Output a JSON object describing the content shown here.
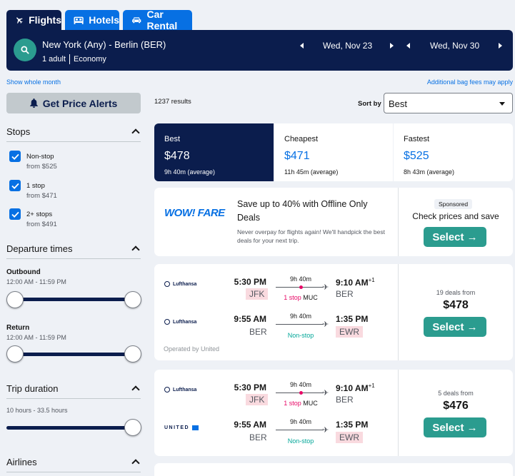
{
  "tabs": [
    {
      "label": "Flights",
      "icon": "plane-icon"
    },
    {
      "label": "Hotels",
      "icon": "bed-icon"
    },
    {
      "label": "Car Rental",
      "icon": "car-icon"
    }
  ],
  "search": {
    "route": "New York (Any) - Berlin (BER)",
    "passengers": "1 adult",
    "cabin": "Economy",
    "depart_date": "Wed, Nov 23",
    "return_date": "Wed, Nov 30"
  },
  "links": {
    "show_month": "Show whole month",
    "bag_fees": "Additional bag fees may apply"
  },
  "sidebar": {
    "alerts_button": "Get Price Alerts",
    "stops_title": "Stops",
    "stops": [
      {
        "label": "Non-stop",
        "price": "from $525",
        "checked": true
      },
      {
        "label": "1 stop",
        "price": "from $471",
        "checked": true
      },
      {
        "label": "2+ stops",
        "price": "from $491",
        "checked": true
      }
    ],
    "departure_title": "Departure times",
    "outbound_label": "Outbound",
    "outbound_range": "12:00 AM - 11:59 PM",
    "return_label": "Return",
    "return_range": "12:00 AM - 11:59 PM",
    "duration_title": "Trip duration",
    "duration_range": "10 hours - 33.5 hours",
    "airlines_title": "Airlines"
  },
  "results": {
    "count": "1237 results",
    "sort_label": "Sort by",
    "sort_value": "Best"
  },
  "sort_tabs": [
    {
      "title": "Best",
      "price": "$478",
      "sub": "9h 40m (average)",
      "active": true
    },
    {
      "title": "Cheapest",
      "price": "$471",
      "sub": "11h 45m (average)",
      "active": false
    },
    {
      "title": "Fastest",
      "price": "$525",
      "sub": "8h 43m (average)",
      "active": false
    }
  ],
  "ad": {
    "logo": "WOW! FARE",
    "headline": "Save up to 40% with Offline Only Deals",
    "body": "Never overpay for flights again! We'll handpick the best deals for your next trip.",
    "sponsored": "Sponsored",
    "cta_text": "Check prices and save",
    "button": "Select →"
  },
  "flights": [
    {
      "legs": [
        {
          "airline": "Lufthansa",
          "dep_time": "5:30 PM",
          "dep_apt": "JFK",
          "duration": "9h 40m",
          "stops": "1 stop",
          "via": "MUC",
          "arr_time": "9:10 AM",
          "plus": "+1",
          "arr_apt": "BER"
        },
        {
          "airline": "Lufthansa",
          "dep_time": "9:55 AM",
          "dep_apt": "BER",
          "duration": "9h 40m",
          "stops": "Non-stop",
          "via": "",
          "arr_time": "1:35 PM",
          "plus": "",
          "arr_apt": "EWR"
        }
      ],
      "operated": "Operated by United",
      "deals": "19 deals from",
      "price": "$478",
      "button": "Select →"
    },
    {
      "legs": [
        {
          "airline": "Lufthansa",
          "dep_time": "5:30 PM",
          "dep_apt": "JFK",
          "duration": "9h 40m",
          "stops": "1 stop",
          "via": "MUC",
          "arr_time": "9:10 AM",
          "plus": "+1",
          "arr_apt": "BER"
        },
        {
          "airline": "UNITED",
          "dep_time": "9:55 AM",
          "dep_apt": "BER",
          "duration": "9h 40m",
          "stops": "Non-stop",
          "via": "",
          "arr_time": "1:35 PM",
          "plus": "",
          "arr_apt": "EWR"
        }
      ],
      "operated": "",
      "deals": "5 deals from",
      "price": "$476",
      "button": "Select →"
    }
  ],
  "colors": {
    "navy": "#0b1d4d",
    "blue": "#0770e3",
    "teal": "#2b9c8f",
    "stop_red": "#e70866",
    "nonstop_green": "#00a698"
  }
}
